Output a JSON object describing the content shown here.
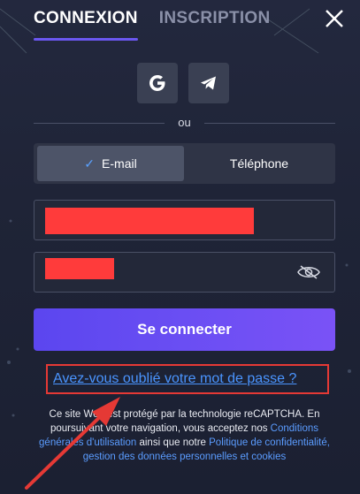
{
  "tabs": {
    "login": "CONNEXION",
    "register": "INSCRIPTION"
  },
  "social": {
    "google_icon": "google-icon",
    "telegram_icon": "telegram-icon"
  },
  "divider": "ou",
  "method": {
    "email": "E-mail",
    "phone": "Téléphone",
    "selected": "email"
  },
  "submit_label": "Se connecter",
  "forgot_label": "Avez-vous oublié votre mot de passe ?",
  "legal": {
    "part1": "Ce site Web est protégé par la technologie reCAPTCHA. En poursuivant votre navigation, vous acceptez nos ",
    "terms_link": "Conditions générales d'utilisation",
    "part2": " ainsi que notre ",
    "privacy_link": "Politique de confidentialité, gestion des données personnelles et cookies"
  },
  "colors": {
    "accent": "#6b57f0",
    "link": "#4a95ff",
    "highlight_box": "#e53935",
    "redaction": "#ff3b3b"
  }
}
